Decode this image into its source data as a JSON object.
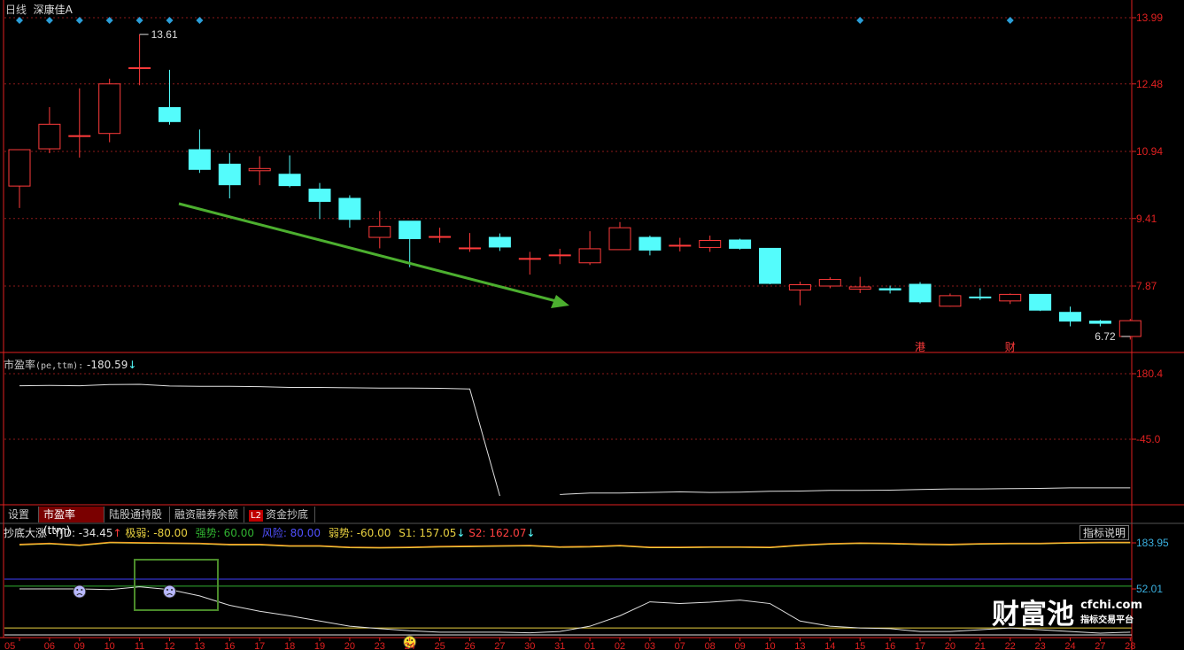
{
  "header": {
    "period": "日线",
    "stock_name": "深康佳A"
  },
  "candles": [
    {
      "o": 10.15,
      "h": 10.98,
      "l": 9.65,
      "c": 10.98
    },
    {
      "o": 11.0,
      "h": 11.95,
      "l": 10.9,
      "c": 11.56
    },
    {
      "o": 11.3,
      "h": 12.38,
      "l": 10.8,
      "c": 11.3
    },
    {
      "o": 11.35,
      "h": 12.6,
      "l": 11.15,
      "c": 12.48
    },
    {
      "o": 12.85,
      "h": 13.61,
      "l": 12.45,
      "c": 12.85
    },
    {
      "o": 11.94,
      "h": 12.8,
      "l": 11.55,
      "c": 11.62
    },
    {
      "o": 10.98,
      "h": 11.44,
      "l": 10.45,
      "c": 10.53
    },
    {
      "o": 10.65,
      "h": 10.9,
      "l": 9.87,
      "c": 10.18
    },
    {
      "o": 10.5,
      "h": 10.83,
      "l": 10.17,
      "c": 10.55
    },
    {
      "o": 10.42,
      "h": 10.85,
      "l": 10.12,
      "c": 10.16
    },
    {
      "o": 10.08,
      "h": 10.22,
      "l": 9.4,
      "c": 9.8
    },
    {
      "o": 9.87,
      "h": 9.94,
      "l": 9.2,
      "c": 9.39
    },
    {
      "o": 8.98,
      "h": 9.58,
      "l": 8.73,
      "c": 9.23
    },
    {
      "o": 9.35,
      "h": 9.35,
      "l": 8.3,
      "c": 8.95
    },
    {
      "o": 9.0,
      "h": 9.2,
      "l": 8.86,
      "c": 9.0
    },
    {
      "o": 8.74,
      "h": 9.08,
      "l": 8.65,
      "c": 8.74
    },
    {
      "o": 8.98,
      "h": 9.07,
      "l": 8.67,
      "c": 8.76
    },
    {
      "o": 8.5,
      "h": 8.65,
      "l": 8.13,
      "c": 8.5
    },
    {
      "o": 8.58,
      "h": 8.72,
      "l": 8.37,
      "c": 8.58
    },
    {
      "o": 8.4,
      "h": 9.12,
      "l": 8.35,
      "c": 8.72
    },
    {
      "o": 8.7,
      "h": 9.33,
      "l": 8.7,
      "c": 9.2
    },
    {
      "o": 8.98,
      "h": 9.02,
      "l": 8.57,
      "c": 8.69
    },
    {
      "o": 8.8,
      "h": 8.97,
      "l": 8.66,
      "c": 8.8
    },
    {
      "o": 8.75,
      "h": 9.02,
      "l": 8.65,
      "c": 8.91
    },
    {
      "o": 8.92,
      "h": 8.95,
      "l": 8.7,
      "c": 8.73
    },
    {
      "o": 8.73,
      "h": 8.73,
      "l": 7.91,
      "c": 7.93
    },
    {
      "o": 7.78,
      "h": 7.97,
      "l": 7.43,
      "c": 7.9
    },
    {
      "o": 7.87,
      "h": 8.07,
      "l": 7.82,
      "c": 8.02
    },
    {
      "o": 7.8,
      "h": 8.08,
      "l": 7.71,
      "c": 7.85
    },
    {
      "o": 7.81,
      "h": 7.88,
      "l": 7.7,
      "c": 7.78
    },
    {
      "o": 7.91,
      "h": 7.96,
      "l": 7.47,
      "c": 7.51
    },
    {
      "o": 7.41,
      "h": 7.7,
      "l": 7.4,
      "c": 7.65
    },
    {
      "o": 7.62,
      "h": 7.82,
      "l": 7.55,
      "c": 7.61
    },
    {
      "o": 7.53,
      "h": 7.7,
      "l": 7.46,
      "c": 7.68
    },
    {
      "o": 7.68,
      "h": 7.68,
      "l": 7.3,
      "c": 7.32
    },
    {
      "o": 7.27,
      "h": 7.4,
      "l": 6.95,
      "c": 7.07
    },
    {
      "o": 7.07,
      "h": 7.1,
      "l": 6.95,
      "c": 7.02
    },
    {
      "o": 6.72,
      "h": 7.12,
      "l": 6.65,
      "c": 7.08
    }
  ],
  "price_axis": [
    "13.99",
    "12.48",
    "10.94",
    "9.41",
    "7.87"
  ],
  "price_labels": {
    "high": "13.61",
    "low": "6.72"
  },
  "event_markers": [
    "港",
    "财"
  ],
  "pe_panel": {
    "label": "市盈率",
    "label_params": "(pe,ttm):",
    "value": "-180.59",
    "arrow": "↓",
    "axis": [
      "180.4",
      "-45.0"
    ],
    "series": [
      139,
      140,
      139,
      143,
      144,
      138,
      137,
      137,
      136,
      133,
      133,
      132,
      131,
      131,
      130,
      128,
      -240,
      null,
      -235,
      -230,
      -230,
      -228,
      -226,
      -228,
      -227,
      -224,
      -223,
      -221,
      -221,
      -220,
      -218,
      -216,
      -216,
      -215,
      -214,
      -212,
      -212,
      -212
    ]
  },
  "tabs": [
    {
      "label": "设置",
      "active": false
    },
    {
      "label": "市盈率(ttm)",
      "active": true
    },
    {
      "label": "陆股通持股",
      "active": false
    },
    {
      "label": "融资融券余额",
      "active": false
    },
    {
      "label": "资金抄底",
      "active": false,
      "badge": "L2"
    }
  ],
  "indicator": {
    "name": "抄底大涨",
    "yjd": "YJD: -34.45",
    "yjd_arrow": "↑",
    "jiruo": "极弱: -80.00",
    "qiangshi": "强势: 60.00",
    "fengxian": "风险: 80.00",
    "ruoshi": "弱势: -60.00",
    "s1": "S1: 157.05",
    "s1_arrow": "↓",
    "s2": "S2: 162.07",
    "s2_arrow": "↓",
    "explain_button": "指标说明",
    "axis": [
      "183.95",
      "52.01"
    ],
    "yjd_series": [
      52,
      52,
      52,
      50,
      58,
      50,
      32,
      5,
      -12,
      -25,
      -40,
      -55,
      -62,
      -68,
      -72,
      -72,
      -72,
      -74,
      -70,
      -55,
      -25,
      15,
      10,
      14,
      20,
      10,
      -40,
      -55,
      -60,
      -62,
      -70,
      -70,
      -65,
      -60,
      -65,
      -70,
      -75,
      -72
    ],
    "s1_series": [
      178,
      181,
      176,
      184,
      183,
      182,
      181,
      178,
      178,
      174,
      174,
      170,
      169,
      170,
      172,
      173,
      174,
      175,
      171,
      172,
      175,
      170,
      170,
      171,
      171,
      170,
      176,
      180,
      182,
      181,
      179,
      178,
      180,
      181,
      181,
      183,
      184,
      184
    ],
    "s2_series": [
      180,
      183,
      178,
      186,
      185,
      184,
      183,
      180,
      180,
      176,
      176,
      172,
      171,
      172,
      174,
      175,
      176,
      177,
      173,
      174,
      177,
      172,
      172,
      173,
      173,
      172,
      178,
      182,
      184,
      183,
      181,
      180,
      182,
      183,
      183,
      185,
      186,
      186
    ]
  },
  "dates": [
    "05",
    "06",
    "09",
    "10",
    "11",
    "12",
    "13",
    "16",
    "17",
    "18",
    "19",
    "20",
    "23",
    "24",
    "25",
    "26",
    "27",
    "30",
    "31",
    "01",
    "02",
    "03",
    "07",
    "08",
    "09",
    "10",
    "13",
    "14",
    "15",
    "16",
    "17",
    "20",
    "21",
    "22",
    "23",
    "24",
    "27",
    "28"
  ],
  "colors": {
    "up": "#ff3b3b",
    "down": "#54fcfc",
    "axis_red": "#e02020",
    "grid_red": "#8b1a1a",
    "white_line": "#e0e0e0",
    "arrow_green": "#4caf2f",
    "box_green": "#4a8a2a",
    "yellow": "#e8d040",
    "orange": "#ff8c1a",
    "blue": "#4040ff",
    "green": "#30b030",
    "marker_blue": "#2b9ed8"
  },
  "logo": {
    "main": "财富池",
    "site": "cfchi.com",
    "sub": "指标交易平台"
  }
}
